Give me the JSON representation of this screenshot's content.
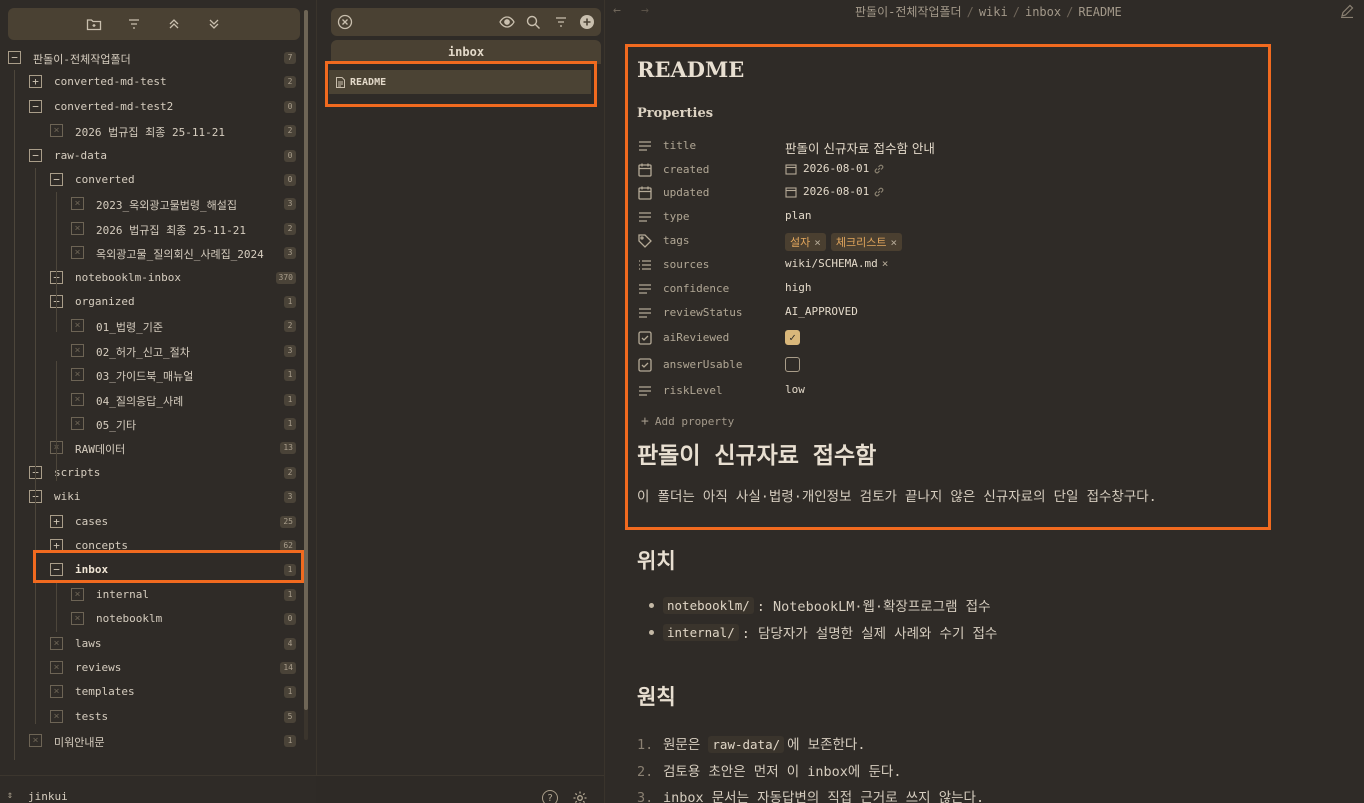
{
  "tree": {
    "root": {
      "label": "판돌이-전체작업폴더",
      "count": "7"
    },
    "items": [
      {
        "label": "converted-md-test",
        "count": "2",
        "state": "closed"
      },
      {
        "label": "converted-md-test2",
        "count": "0",
        "state": "open"
      },
      {
        "label": "2026 법규집 최종 25-11-21",
        "count": "2",
        "state": "file"
      },
      {
        "label": "raw-data",
        "count": "0",
        "state": "open"
      },
      {
        "label": "converted",
        "count": "0",
        "state": "open"
      },
      {
        "label": "2023_옥외광고물법령_해설집",
        "count": "3",
        "state": "file"
      },
      {
        "label": "2026 법규집 최종 25-11-21",
        "count": "2",
        "state": "file"
      },
      {
        "label": "옥외광고물_질의회신_사례집_2024",
        "count": "3",
        "state": "file"
      },
      {
        "label": "notebooklm-inbox",
        "count": "370",
        "state": "closed"
      },
      {
        "label": "organized",
        "count": "1",
        "state": "open"
      },
      {
        "label": "01_법령_기준",
        "count": "2",
        "state": "file"
      },
      {
        "label": "02_허가_신고_절차",
        "count": "3",
        "state": "file"
      },
      {
        "label": "03_가이드북_매뉴얼",
        "count": "1",
        "state": "file"
      },
      {
        "label": "04_질의응답_사례",
        "count": "1",
        "state": "file"
      },
      {
        "label": "05_기타",
        "count": "1",
        "state": "file"
      },
      {
        "label": "RAW데이터",
        "count": "13",
        "state": "file"
      },
      {
        "label": "scripts",
        "count": "2",
        "state": "closed"
      },
      {
        "label": "wiki",
        "count": "3",
        "state": "open"
      },
      {
        "label": "cases",
        "count": "25",
        "state": "closed"
      },
      {
        "label": "concepts",
        "count": "62",
        "state": "closed"
      },
      {
        "label": "inbox",
        "count": "1",
        "state": "open"
      },
      {
        "label": "internal",
        "count": "1",
        "state": "file"
      },
      {
        "label": "notebooklm",
        "count": "0",
        "state": "file"
      },
      {
        "label": "laws",
        "count": "4",
        "state": "file"
      },
      {
        "label": "reviews",
        "count": "14",
        "state": "file"
      },
      {
        "label": "templates",
        "count": "1",
        "state": "file"
      },
      {
        "label": "tests",
        "count": "5",
        "state": "file"
      },
      {
        "label": "미워안내문",
        "count": "1",
        "state": "file"
      }
    ]
  },
  "user": {
    "name": "jinkui"
  },
  "list": {
    "folder": "inbox",
    "file": "README"
  },
  "editor": {
    "breadcrumb": [
      "판돌이-전체작업폴더",
      "wiki",
      "inbox",
      "README"
    ],
    "title": "README",
    "properties_heading": "Properties",
    "properties": {
      "title": {
        "name": "title",
        "value": "판돌이 신규자료 접수함 안내"
      },
      "created": {
        "name": "created",
        "value": "2026-08-01"
      },
      "updated": {
        "name": "updated",
        "value": "2026-08-01"
      },
      "type": {
        "name": "type",
        "value": "plan"
      },
      "tags": {
        "name": "tags",
        "values": [
          "설자",
          "체크리스트"
        ]
      },
      "sources": {
        "name": "sources",
        "value": "wiki/SCHEMA.md"
      },
      "confidence": {
        "name": "confidence",
        "value": "high"
      },
      "reviewStatus": {
        "name": "reviewStatus",
        "value": "AI_APPROVED"
      },
      "aiReviewed": {
        "name": "aiReviewed",
        "checked": true
      },
      "answerUsable": {
        "name": "answerUsable",
        "checked": false
      },
      "riskLevel": {
        "name": "riskLevel",
        "value": "low"
      }
    },
    "add_property": "Add property",
    "h1": "판돌이 신규자료 접수함",
    "intro": "이 폴더는 아직 사실·법령·개인정보 검토가 끝나지 않은 신규자료의 단일 접수창구다.",
    "section_location": "위치",
    "bullets": [
      {
        "code": "notebooklm/",
        "text": ": NotebookLM·웹·확장프로그램 접수"
      },
      {
        "code": "internal/",
        "text": ": 담당자가 설명한 실제 사례와 수기 접수"
      }
    ],
    "section_rules": "원칙",
    "rules": [
      {
        "num": "1.",
        "pre": "원문은 ",
        "code": "raw-data/",
        "post": "에 보존한다."
      },
      {
        "num": "2.",
        "pre": "검토용 초안은 먼저 이 inbox에 둔다.",
        "code": "",
        "post": ""
      },
      {
        "num": "3.",
        "pre": "inbox 문서는 자동답변의 직접 근거로 쓰지 않는다.",
        "code": "",
        "post": ""
      }
    ]
  },
  "colors": {
    "highlight": "#f16a1f",
    "accent": "#d9b77a",
    "tag": "#e2a65c"
  }
}
